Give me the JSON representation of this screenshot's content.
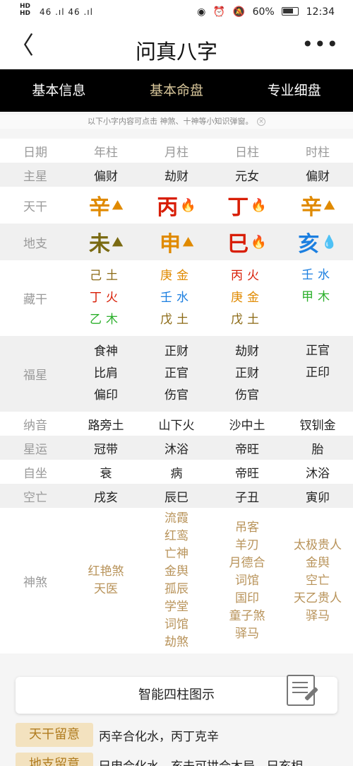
{
  "status": {
    "hd1": "HD",
    "hd2": "HD",
    "signal": "46 .ıl 46 .ıl",
    "battery": "60%",
    "time": "12:34"
  },
  "appbar": {
    "title": "问真八字",
    "back": "〈",
    "more": "•••"
  },
  "tabs": [
    "基本信息",
    "基本命盘",
    "专业细盘"
  ],
  "notice": "以下小字内容可点击 神煞、十神等小知识弹窗。",
  "labels": {
    "date": "日期",
    "main_star": "主星",
    "tiangan": "天干",
    "dizhi": "地支",
    "canggan": "藏干",
    "fuxing": "福星",
    "nayin": "纳音",
    "xingyun": "星运",
    "zizuo": "自坐",
    "kongwang": "空亡",
    "shensha": "神煞"
  },
  "columns": [
    "年柱",
    "月柱",
    "日柱",
    "时柱"
  ],
  "main_star": [
    "偏财",
    "劫财",
    "元女",
    "偏财"
  ],
  "tiangan": [
    {
      "char": "辛",
      "icon": "⛰",
      "color": "gold"
    },
    {
      "char": "丙",
      "icon": "🔥",
      "color": "red"
    },
    {
      "char": "丁",
      "icon": "🔥",
      "color": "red"
    },
    {
      "char": "辛",
      "icon": "⛰",
      "color": "gold"
    }
  ],
  "dizhi": [
    {
      "char": "未",
      "icon": "⛰",
      "color": "brown"
    },
    {
      "char": "申",
      "icon": "⛰",
      "color": "gold"
    },
    {
      "char": "巳",
      "icon": "🔥",
      "color": "red"
    },
    {
      "char": "亥",
      "icon": "💧",
      "color": "blue"
    }
  ],
  "canggan": [
    [
      "己土",
      "丁火",
      "乙木"
    ],
    [
      "庚金",
      "壬水",
      "戊土"
    ],
    [
      "丙火",
      "庚金",
      "戊土"
    ],
    [
      "壬水",
      "甲木"
    ]
  ],
  "fuxing": [
    [
      "食神",
      "比肩",
      "偏印"
    ],
    [
      "正财",
      "正官",
      "伤官"
    ],
    [
      "劫财",
      "正财",
      "伤官"
    ],
    [
      "正官",
      "正印"
    ]
  ],
  "nayin": [
    "路旁土",
    "山下火",
    "沙中土",
    "钗钏金"
  ],
  "xingyun": [
    "冠带",
    "沐浴",
    "帝旺",
    "胎"
  ],
  "zizuo": [
    "衰",
    "病",
    "帝旺",
    "沐浴"
  ],
  "kongwang": [
    "戌亥",
    "辰巳",
    "子丑",
    "寅卯"
  ],
  "shensha": [
    [
      "红艳煞",
      "天医"
    ],
    [
      "流霞",
      "红鸾",
      "亡神",
      "金舆",
      "孤辰",
      "学堂",
      "词馆",
      "劫煞"
    ],
    [
      "吊客",
      "羊刃",
      "月德合",
      "词馆",
      "国印",
      "童子煞",
      "驿马"
    ],
    [
      "太极贵人",
      "金舆",
      "空亡",
      "天乙贵人",
      "驿马"
    ]
  ],
  "card": {
    "label": "智能四柱图示"
  },
  "tags": [
    {
      "tag": "天干留意",
      "text": "丙辛合化水，丙丁克辛"
    },
    {
      "tag": "地支留意",
      "text": "巳申合化水，亥未可拱合木局，巳亥相"
    }
  ]
}
